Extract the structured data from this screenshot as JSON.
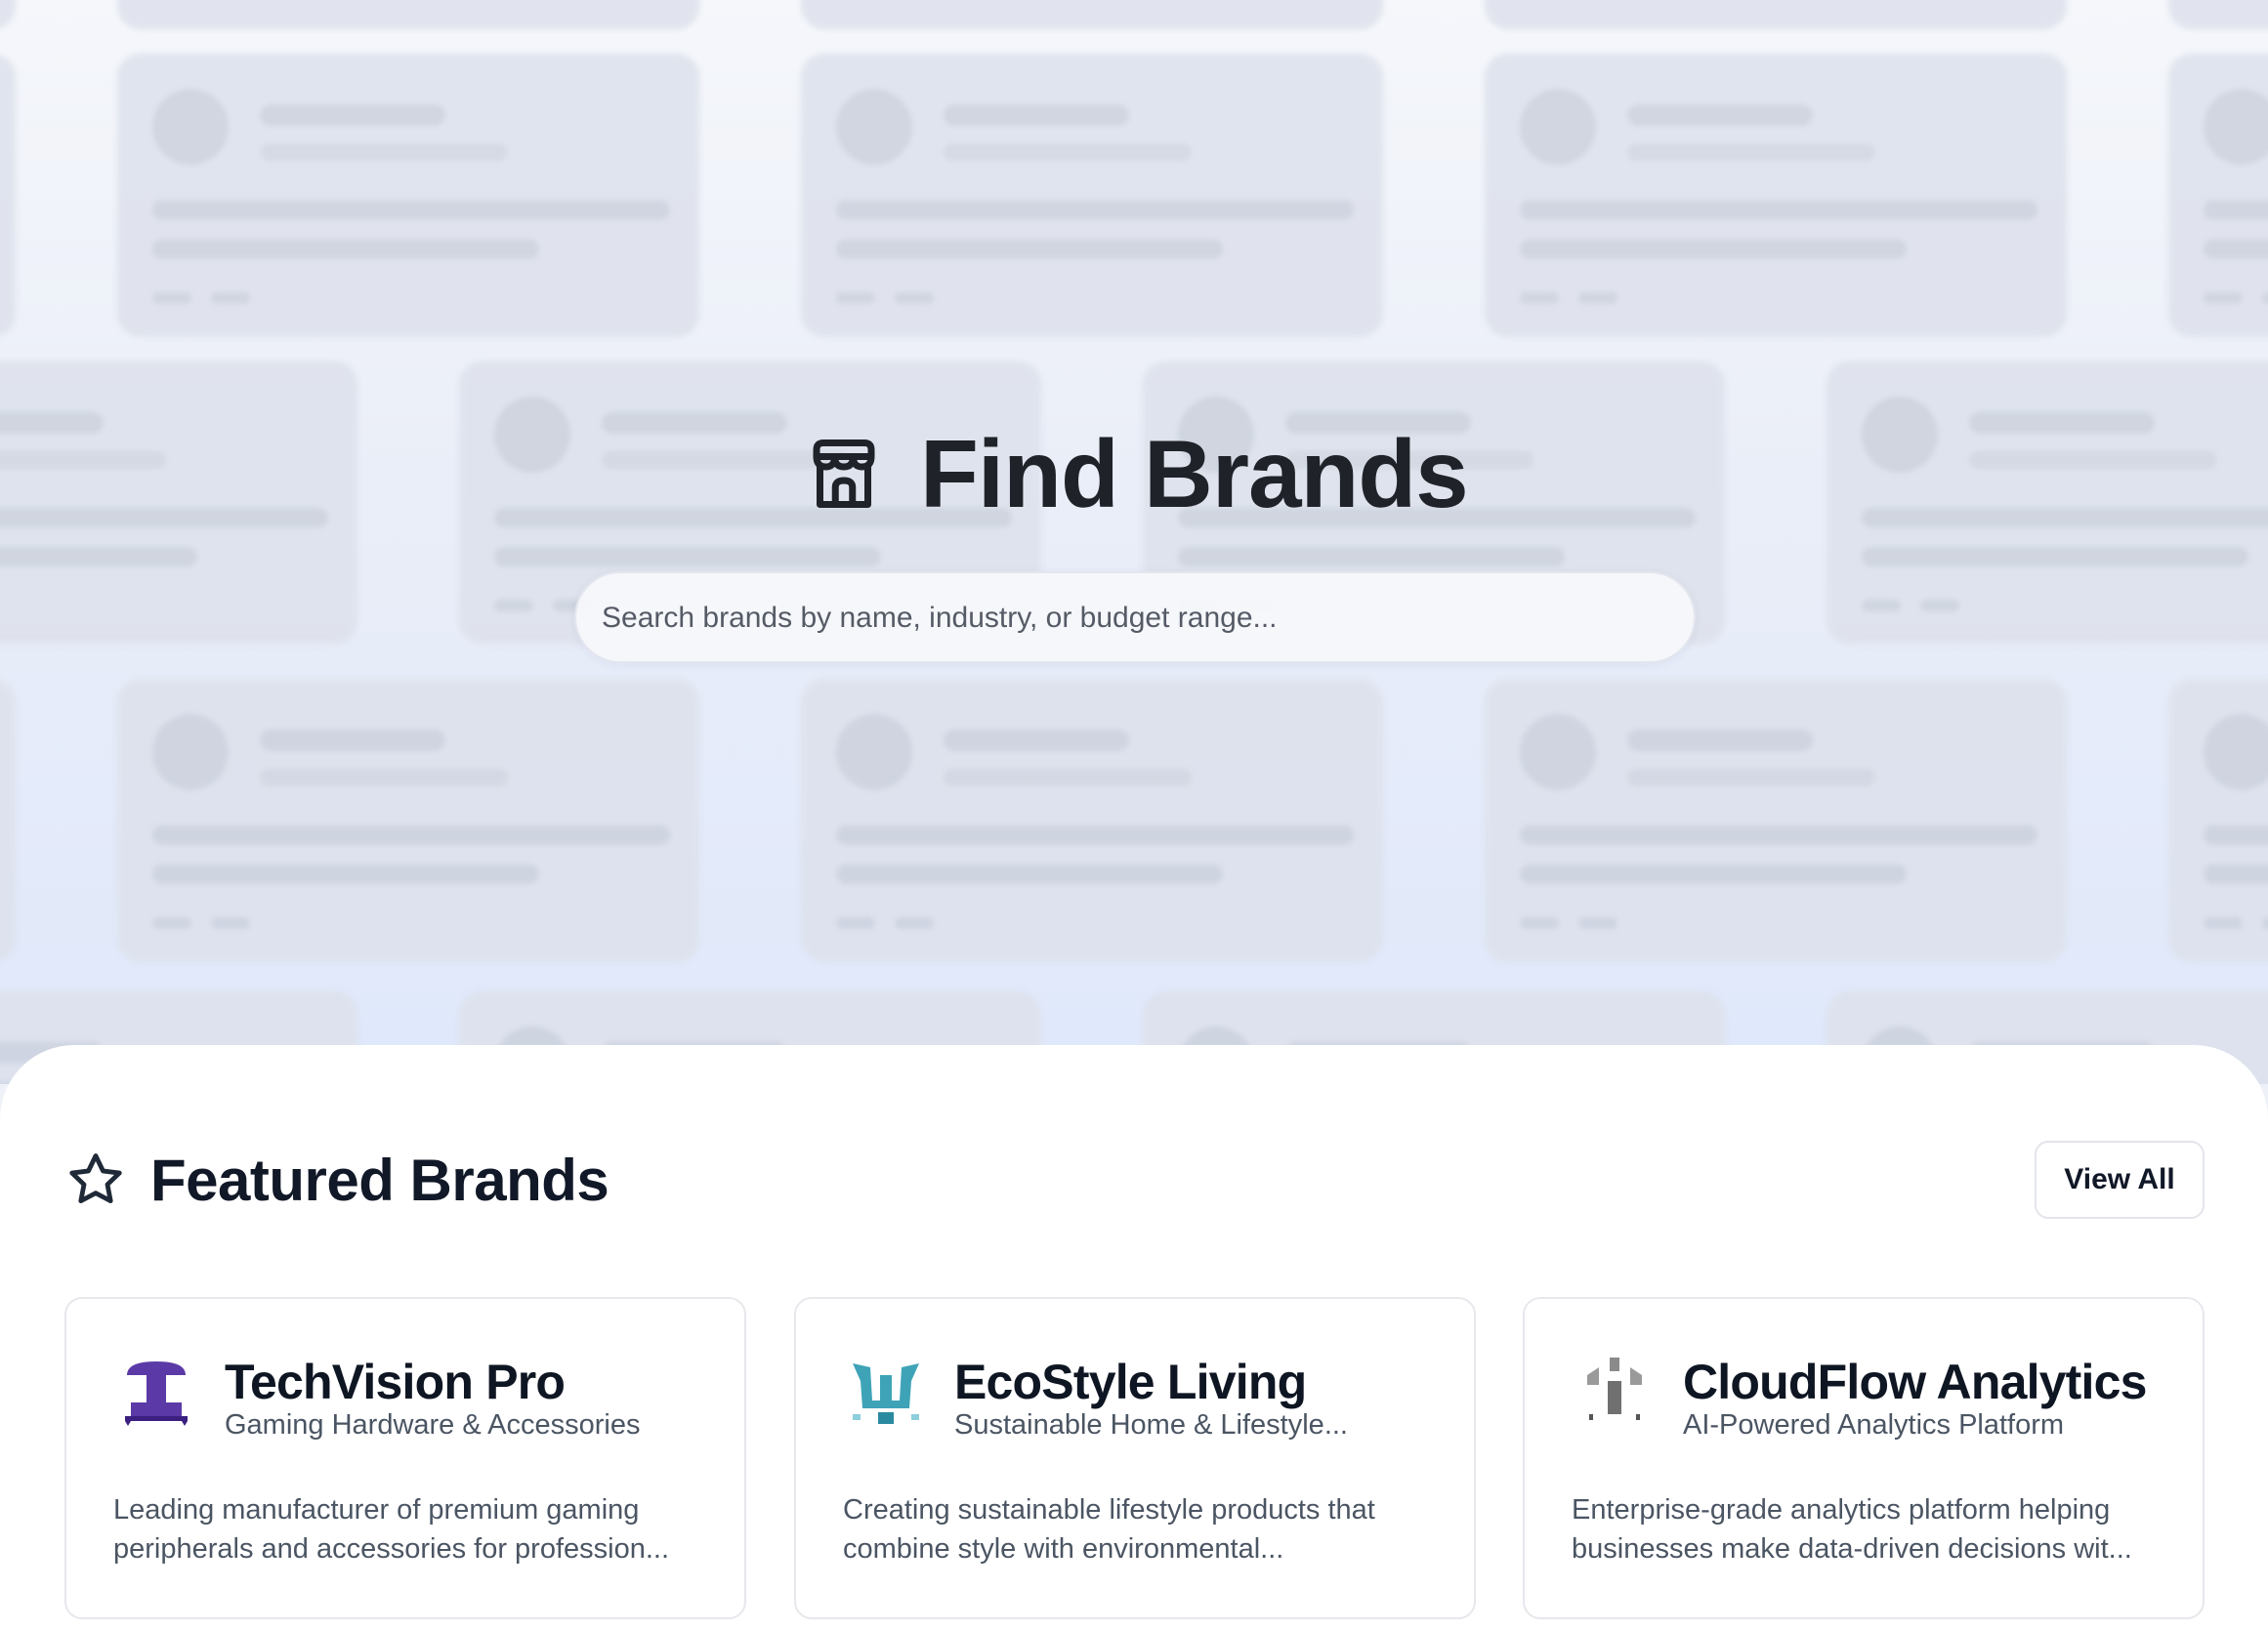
{
  "hero": {
    "title": "Find Brands",
    "search_placeholder": "Search brands by name, industry, or budget range..."
  },
  "featured": {
    "title": "Featured Brands",
    "view_all_label": "View All",
    "brands": [
      {
        "name": "TechVision Pro",
        "category": "Gaming Hardware & Accessories",
        "description": "Leading manufacturer of premium gaming peripherals and accessories for profession...",
        "logo_color": "#5b3aa8"
      },
      {
        "name": "EcoStyle Living",
        "category": "Sustainable Home & Lifestyle...",
        "description": "Creating sustainable lifestyle products that combine style with environmental...",
        "logo_color": "#3fa3b8"
      },
      {
        "name": "CloudFlow Analytics",
        "category": "AI-Powered Analytics Platform",
        "description": "Enterprise-grade analytics platform helping businesses make data-driven decisions wit...",
        "logo_color": "#707070"
      }
    ]
  }
}
